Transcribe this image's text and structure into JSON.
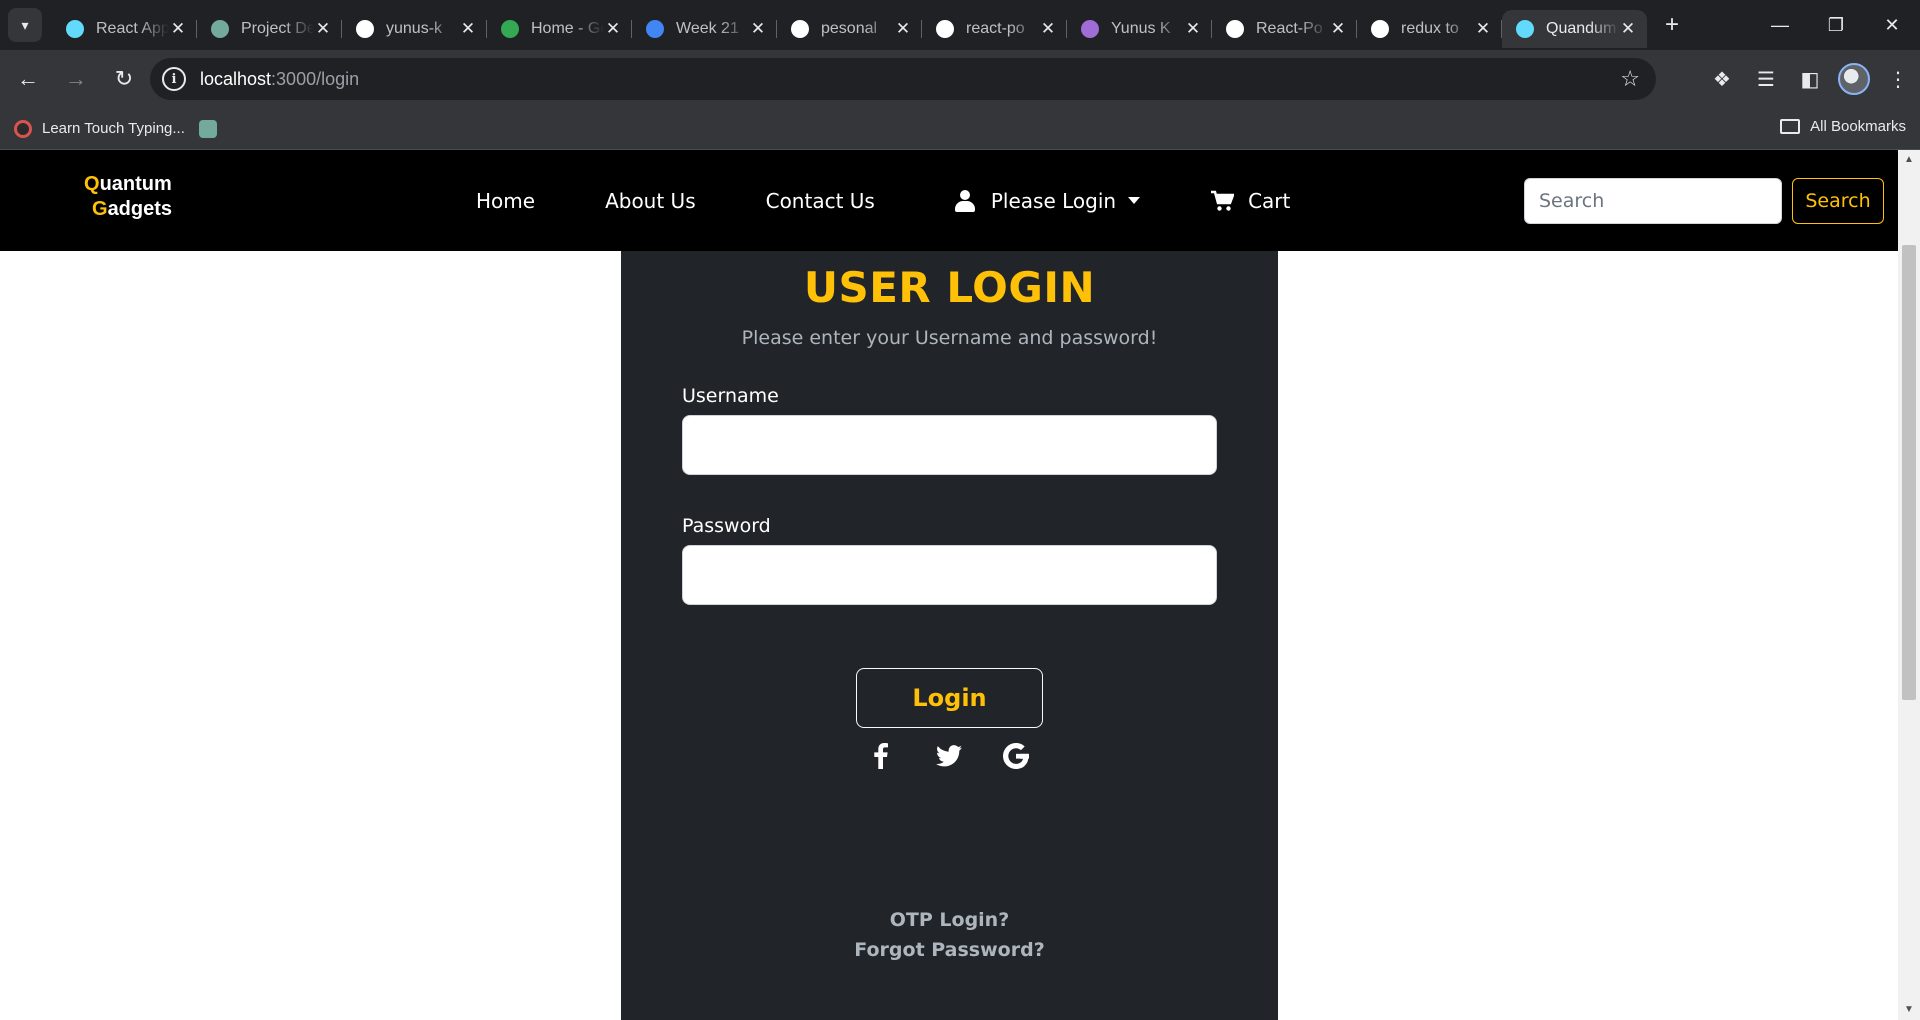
{
  "browser": {
    "tabs": [
      {
        "title": "React App",
        "favicon": "react-icon",
        "color": "#61dafb"
      },
      {
        "title": "Project Details",
        "favicon": "chatgpt-icon",
        "color": "#74aa9c"
      },
      {
        "title": "yunus-k",
        "favicon": "github-icon",
        "color": "#ffffff"
      },
      {
        "title": "Home - Google Drive",
        "favicon": "drive-icon",
        "color": "#34a853"
      },
      {
        "title": "Week 21",
        "favicon": "docs-icon",
        "color": "#4285f4"
      },
      {
        "title": "pesonal",
        "favicon": "github-icon",
        "color": "#ffffff"
      },
      {
        "title": "react-po",
        "favicon": "github-icon",
        "color": "#ffffff"
      },
      {
        "title": "Yunus K",
        "favicon": "profile-icon",
        "color": "#a06cd5"
      },
      {
        "title": "React-Po",
        "favicon": "github-icon",
        "color": "#ffffff"
      },
      {
        "title": "redux to",
        "favicon": "google-icon",
        "color": "#ffffff"
      },
      {
        "title": "Quandum",
        "favicon": "react-icon",
        "color": "#61dafb",
        "active": true
      }
    ],
    "url_host": "localhost",
    "url_rest": ":3000/login",
    "bookmarks": [
      {
        "label": "Learn Touch Typing...",
        "icon": "typing-icon"
      },
      {
        "label": "",
        "icon": "chatgpt-icon"
      }
    ],
    "all_bookmarks_label": "All Bookmarks"
  },
  "site": {
    "brand_first_initial": "Q",
    "brand_first_rest": "uantum",
    "brand_second_initial": "G",
    "brand_second_rest": "adgets",
    "nav": {
      "home": "Home",
      "about": "About Us",
      "contact": "Contact Us",
      "login": "Please Login",
      "cart": "Cart"
    },
    "search": {
      "placeholder": "Search",
      "button": "Search"
    },
    "accent_color": "#ffc107"
  },
  "login": {
    "title": "USER LOGIN",
    "subtitle": "Please enter your Username and password!",
    "username_label": "Username",
    "username_value": "",
    "password_label": "Password",
    "password_value": "",
    "button": "Login",
    "socials": [
      "facebook-icon",
      "twitter-icon",
      "google-icon"
    ],
    "otp_link": "OTP Login?",
    "forgot_link": "Forgot Password?"
  }
}
